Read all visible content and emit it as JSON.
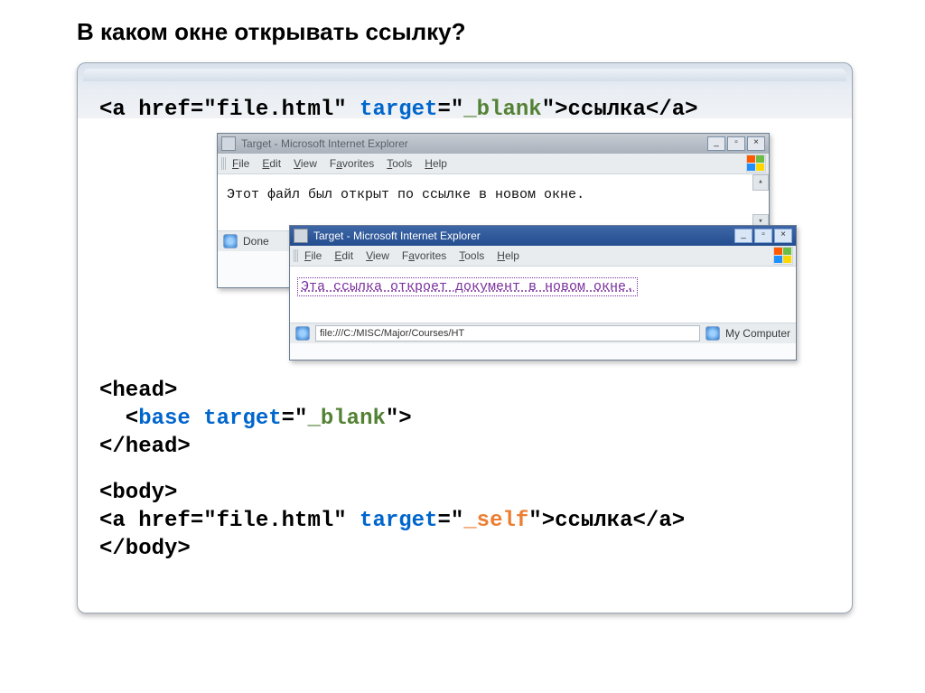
{
  "title": "В каком окне открывать ссылку?",
  "code1": {
    "p1": "<a href=\"file.html\" ",
    "attr": "target",
    "eq": "=\"",
    "val": "_blank",
    "p2": "\">ссылка</a>"
  },
  "ie_back": {
    "title": "Target - Microsoft Internet Explorer",
    "menu_file": "File",
    "menu_edit": "Edit",
    "menu_view": "View",
    "menu_fav": "Favorites",
    "menu_tools": "Tools",
    "menu_help": "Help",
    "body": "Этот файл был открыт по ссылке в новом окне.",
    "status_done": "Done"
  },
  "ie_front": {
    "title": "Target - Microsoft Internet Explorer",
    "menu_file": "File",
    "menu_edit": "Edit",
    "menu_view": "View",
    "menu_fav": "Favorites",
    "menu_tools": "Tools",
    "menu_help": "Help",
    "body": "Эта ссылка откроет документ в новом окне.",
    "addr": "file:///C:/MISC/Major/Courses/HT",
    "status_text": "My Computer"
  },
  "code_head": {
    "l1": "<head>",
    "l2a": "  <",
    "l2b": "base target",
    "l2c": "=\"",
    "l2d": "_blank",
    "l2e": "\">",
    "l3": "</head>"
  },
  "code_body": {
    "l1": "<body>",
    "l2a": "<a href=\"file.html\" ",
    "l2attr": "target",
    "l2eq": "=\"",
    "l2val": "_self",
    "l2b": "\">ссылка</a>",
    "l3": "</body>"
  }
}
